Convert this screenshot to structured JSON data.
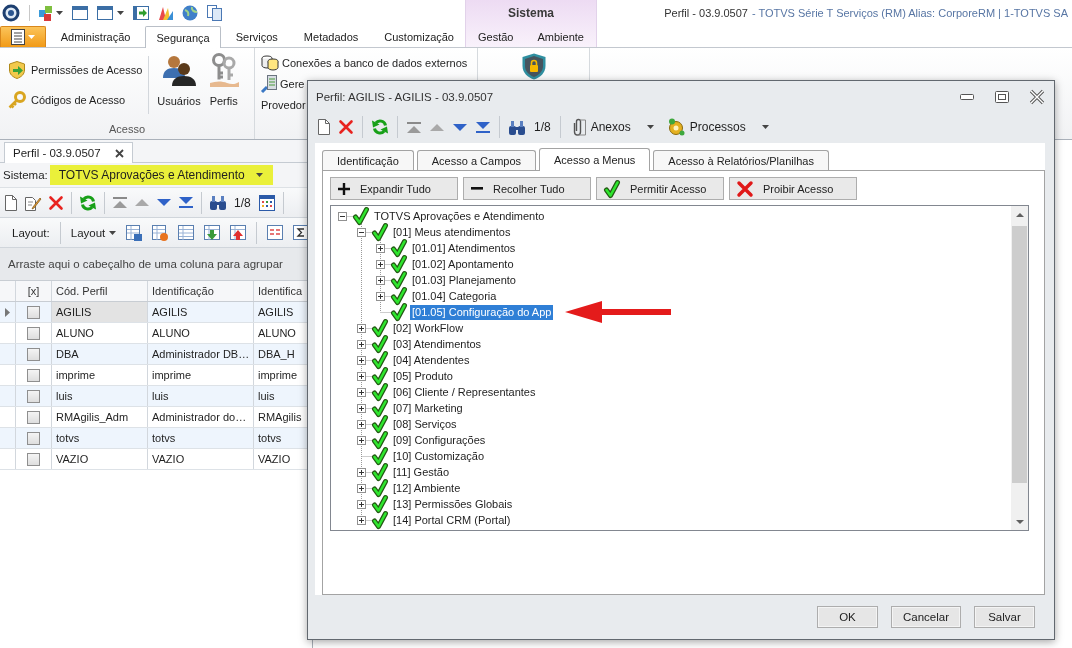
{
  "window": {
    "title": "Perfil - 03.9.0507",
    "subtitle": "- TOTVS Série T Serviços (RM) Alias: CorporeRM | 1-TOTVS SA"
  },
  "ribbon": {
    "tabs": [
      {
        "label": "Administração",
        "selected": false
      },
      {
        "label": "Segurança",
        "selected": true
      },
      {
        "label": "Serviços",
        "selected": false
      },
      {
        "label": "Metadados",
        "selected": false
      },
      {
        "label": "Customização",
        "selected": false
      }
    ],
    "context_group": {
      "title": "Sistema",
      "tabs": [
        {
          "label": "Gestão",
          "selected": false
        },
        {
          "label": "Ambiente",
          "selected": false
        }
      ]
    },
    "groups": [
      {
        "label": "Acesso",
        "buttons": [
          {
            "kind": "small",
            "label": "Permissões de Acesso"
          },
          {
            "kind": "small",
            "label": "Códigos de Acesso"
          },
          {
            "kind": "large",
            "label": "Usuários"
          },
          {
            "kind": "large",
            "label": "Perfis"
          }
        ]
      },
      {
        "buttons": [
          {
            "kind": "small",
            "label": "Conexões a banco de dados externos"
          },
          {
            "kind": "small",
            "label": "Gere"
          },
          {
            "kind": "label",
            "label": "Provedor"
          }
        ]
      }
    ]
  },
  "document_tab": {
    "label": "Perfil - 03.9.0507"
  },
  "filter": {
    "label": "Sistema:",
    "value": "TOTVS Aprovações e Atendimento",
    "highlighted": true
  },
  "toolbar": {
    "record_position": "1/8"
  },
  "layout_bar": {
    "label": "Layout:",
    "menu": "Layout"
  },
  "group_panel": {
    "hint": "Arraste aqui o cabeçalho de uma coluna para agrupar"
  },
  "grid": {
    "check_column": "[x]",
    "columns": [
      "Cód. Perfil",
      "Identificação",
      "Identifica"
    ],
    "rows": [
      {
        "selected": true,
        "checked": false,
        "cells": [
          "AGILIS",
          "AGILIS",
          "AGILIS"
        ]
      },
      {
        "selected": false,
        "checked": false,
        "cells": [
          "ALUNO",
          "ALUNO",
          "ALUNO"
        ]
      },
      {
        "selected": false,
        "checked": false,
        "cells": [
          "DBA",
          "Administrador DB…",
          "DBA_H"
        ]
      },
      {
        "selected": false,
        "checked": false,
        "cells": [
          "imprime",
          "imprime",
          "imprime"
        ]
      },
      {
        "selected": false,
        "checked": false,
        "cells": [
          "luis",
          "luis",
          "luis"
        ]
      },
      {
        "selected": false,
        "checked": false,
        "cells": [
          "RMAgilis_Adm",
          "Administrador do…",
          "RMAgilis"
        ]
      },
      {
        "selected": false,
        "checked": false,
        "cells": [
          "totvs",
          "totvs",
          "totvs"
        ]
      },
      {
        "selected": false,
        "checked": false,
        "cells": [
          "VAZIO",
          "VAZIO",
          "VAZIO"
        ]
      }
    ]
  },
  "dialog": {
    "title": "Perfil: AGILIS - AGILIS - 03.9.0507",
    "toolbar": {
      "record_position": "1/8",
      "menus": [
        "Anexos",
        "Processos"
      ]
    },
    "tabs": [
      {
        "label": "Identificação",
        "selected": false
      },
      {
        "label": "Acesso a Campos",
        "selected": false
      },
      {
        "label": "Acesso a Menus",
        "selected": true
      },
      {
        "label": "Acesso à Relatórios/Planilhas",
        "selected": false
      }
    ],
    "actions": [
      "Expandir Tudo",
      "Recolher Tudo",
      "Permitir Acesso",
      "Proibir Acesso"
    ],
    "tree": [
      {
        "label": "TOTVS Aprovações e Atendimento",
        "kind": "branch",
        "expanded": true,
        "allowed": true,
        "selected": false,
        "children": [
          {
            "label": "[01] Meus atendimentos",
            "kind": "branch",
            "expanded": true,
            "allowed": true,
            "selected": false,
            "children": [
              {
                "label": "[01.01] Atendimentos",
                "kind": "branch",
                "expanded": false,
                "allowed": true,
                "selected": false
              },
              {
                "label": "[01.02] Apontamento",
                "kind": "branch",
                "expanded": false,
                "allowed": true,
                "selected": false
              },
              {
                "label": "[01.03] Planejamento",
                "kind": "branch",
                "expanded": false,
                "allowed": true,
                "selected": false
              },
              {
                "label": "[01.04] Categoria",
                "kind": "branch",
                "expanded": false,
                "allowed": true,
                "selected": false
              },
              {
                "label": "[01.05] Configuração do App",
                "kind": "leaf",
                "allowed": true,
                "selected": true
              }
            ]
          },
          {
            "label": "[02] WorkFlow",
            "kind": "branch",
            "expanded": false,
            "allowed": true,
            "selected": false
          },
          {
            "label": "[03] Atendimentos",
            "kind": "branch",
            "expanded": false,
            "allowed": true,
            "selected": false
          },
          {
            "label": "[04] Atendentes",
            "kind": "branch",
            "expanded": false,
            "allowed": true,
            "selected": false
          },
          {
            "label": "[05] Produto",
            "kind": "branch",
            "expanded": false,
            "allowed": true,
            "selected": false
          },
          {
            "label": "[06] Cliente / Representantes",
            "kind": "branch",
            "expanded": false,
            "allowed": true,
            "selected": false
          },
          {
            "label": "[07] Marketing",
            "kind": "branch",
            "expanded": false,
            "allowed": true,
            "selected": false
          },
          {
            "label": "[08] Serviços",
            "kind": "branch",
            "expanded": false,
            "allowed": true,
            "selected": false
          },
          {
            "label": "[09] Configurações",
            "kind": "branch",
            "expanded": false,
            "allowed": true,
            "selected": false
          },
          {
            "label": "[10] Customização",
            "kind": "leaf",
            "allowed": true,
            "selected": false
          },
          {
            "label": "[11] Gestão",
            "kind": "branch",
            "expanded": false,
            "allowed": true,
            "selected": false
          },
          {
            "label": "[12] Ambiente",
            "kind": "branch",
            "expanded": false,
            "allowed": true,
            "selected": false
          },
          {
            "label": "[13] Permissões Globais",
            "kind": "branch",
            "expanded": false,
            "allowed": true,
            "selected": false
          },
          {
            "label": "[14] Portal CRM (Portal)",
            "kind": "branch",
            "expanded": false,
            "allowed": true,
            "selected": false
          }
        ]
      }
    ],
    "buttons": [
      "OK",
      "Cancelar",
      "Salvar"
    ]
  }
}
